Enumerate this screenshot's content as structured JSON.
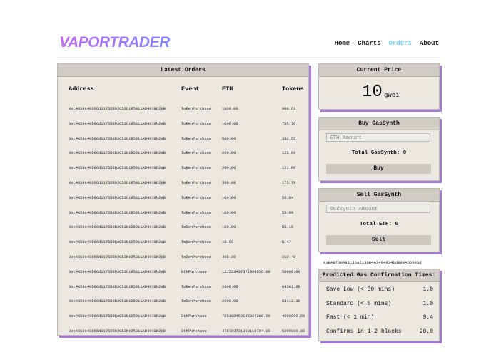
{
  "brand": {
    "logo": "VAPORTRADER"
  },
  "nav": {
    "items": [
      {
        "label": "Home",
        "active": false
      },
      {
        "label": "Charts",
        "active": false
      },
      {
        "label": "Orders",
        "active": true
      },
      {
        "label": "About",
        "active": false
      }
    ]
  },
  "orders": {
    "title": "Latest Orders",
    "columns": [
      "Address",
      "Event",
      "ETH",
      "Tokens"
    ],
    "rows": [
      [
        "0xc4659c40D66d1175D8b3C53b195911AD4938b2eB",
        "TokenPurchase",
        "1000.00",
        "906.61"
      ],
      [
        "0xc4659c40D66d1175D8b3C53b195911AD4938b2eB",
        "TokenPurchase",
        "1000.00",
        "755.70"
      ],
      [
        "0xc4659c40D66d1175D8b3C53b195911AD4938b2eB",
        "TokenPurchase",
        "500.00",
        "332.55"
      ],
      [
        "0xc4659c40D66d1175D8b3C53b195911AD4938b2eB",
        "TokenPurchase",
        "200.00",
        "125.69"
      ],
      [
        "0xc4659c40D66d1175D8b3C53b195911AD4938b2eB",
        "TokenPurchase",
        "200.00",
        "121.80"
      ],
      [
        "0xc4659c40D66d1175D8b3C53b195911AD4938b2eB",
        "TokenPurchase",
        "300.00",
        "175.79"
      ],
      [
        "0xc4659c40D66d1175D8b3C53b195911AD4938b2eB",
        "TokenPurchase",
        "100.00",
        "56.84"
      ],
      [
        "0xc4659c40D66d1175D8b3C53b195911AD4938b2eB",
        "TokenPurchase",
        "100.00",
        "55.99"
      ],
      [
        "0xc4659c40D66d1175D8b3C53b195911AD4938b2eB",
        "TokenPurchase",
        "100.00",
        "55.16"
      ],
      [
        "0xc4659c40D66d1175D8b3C53b195911AD4938b2eB",
        "TokenPurchase",
        "10.00",
        "5.47"
      ],
      [
        "0xc4659c40D66d1175D8b3C53b195911AD4938b2eB",
        "TokenPurchase",
        "400.00",
        "212.42"
      ],
      [
        "0xc4659c40D66d1175D8b3C53b195911AD4938b2eB",
        "EthPurchase",
        "121553437371899856.00",
        "50000.00"
      ],
      [
        "0xc4659c40D66d1175D8b3C53b195911AD4938b2eB",
        "TokenPurchase",
        "2000.00",
        "64361.69"
      ],
      [
        "0xc4659c40D66d1175D8b3C53b195911AD4938b2eB",
        "TokenPurchase",
        "2000.00",
        "63112.30"
      ],
      [
        "0xc4659c40D66d1175D8b3C53b195911AD4938b2eB",
        "EthPurchase",
        "786188469165324288.00",
        "4000000.00"
      ],
      [
        "0xc4659c40D66d1175D8b3C53b195911AD4938b2eB",
        "EthPurchase",
        "478703731939110784.00",
        "5000000.00"
      ]
    ]
  },
  "price": {
    "title": "Current Price",
    "value": "10",
    "unit": "gwei"
  },
  "buy": {
    "title": "Buy GasSynth",
    "placeholder": "ETH Amount",
    "total_label": "Total GasSynth: 0",
    "button": "Buy"
  },
  "sell": {
    "title": "Sell GasSynth",
    "placeholder": "GasSynth Amount",
    "total_label": "Total ETH: 0",
    "button": "Sell"
  },
  "contract_address": "0xBABfD0481c36a2136B4A3404834bd899AD5985d",
  "gas": {
    "title": "Predicted Gas Confirmation Times:",
    "rows": [
      {
        "label": "Save Low (< 30 mins)",
        "value": "1.0"
      },
      {
        "label": "Standard (< 5 mins)",
        "value": "1.0"
      },
      {
        "label": "Fast (< 1 min)",
        "value": "9.4"
      },
      {
        "label": "Confirms in 1-2 blocks",
        "value": "20.0"
      }
    ]
  },
  "colors": {
    "accent": "#a678d6",
    "panel": "#eae8e0",
    "header": "#cfcdc5",
    "nav_active": "#6ecdf0"
  }
}
